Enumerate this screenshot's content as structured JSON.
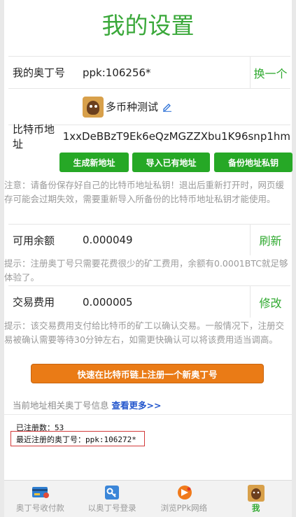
{
  "page_title": "我的设置",
  "odin": {
    "label": "我的奥丁号",
    "value": "ppk:106256*",
    "action": "换一个"
  },
  "profile": {
    "name": "多币种测试",
    "avatar_icon": "bear-avatar-icon",
    "edit_icon": "pencil-icon"
  },
  "btc_address": {
    "label": "比特币地址",
    "value": "1xxDeBBzT9Ek6eQzMGZZXbu1K96snp1hm"
  },
  "buttons": {
    "generate": "生成新地址",
    "import": "导入已有地址",
    "backup": "备份地址私钥"
  },
  "notes": {
    "backup": "注意：请备份保存好自己的比特币地址私钥！退出后重新打开时，网页缓存可能会过期失效，需要重新导入所备份的比特币地址私钥才能使用。",
    "balance": "提示：注册奥丁号只需要花费很少的矿工费用，余额有0.0001BTC就足够体验了。",
    "fee": "提示：该交易费用支付给比特币的矿工以确认交易。一般情况下，注册交易被确认需要等待30分钟左右，如需更快确认可以将该费用适当调高。"
  },
  "balance": {
    "label": "可用余额",
    "value": "0.000049",
    "action": "刷新"
  },
  "fee": {
    "label": "交易费用",
    "value": "0.000005",
    "action": "修改"
  },
  "register_button": "快速在比特币链上注册一个新奥丁号",
  "related_info": {
    "text": "当前地址相关奥丁号信息",
    "link": "查看更多>>"
  },
  "stats": {
    "registered": "已注册数：53",
    "latest": "最近注册的奥丁号：ppk:106272*"
  },
  "tabbar": [
    {
      "label": "奥丁号收付款",
      "icon": "card-icon"
    },
    {
      "label": "以奥丁号登录",
      "icon": "key-icon"
    },
    {
      "label": "浏览PPk网络",
      "icon": "ppk-logo-icon"
    },
    {
      "label": "我",
      "icon": "bear-avatar-icon"
    }
  ],
  "colors": {
    "green": "#26a826",
    "title_green": "#3aa83a",
    "orange": "#ea7b16",
    "link_blue": "#2255cc"
  }
}
